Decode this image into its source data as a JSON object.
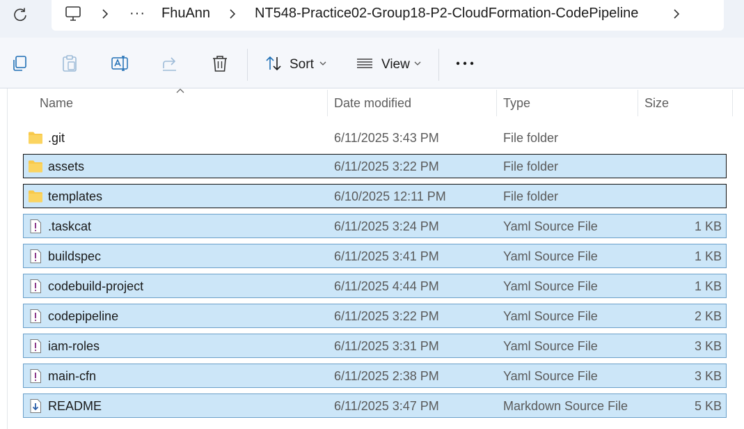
{
  "breadcrumb": {
    "more": "···",
    "items": [
      "FhuAnn",
      "NT548-Practice02-Group18-P2-CloudFormation-CodePipeline"
    ]
  },
  "toolbar": {
    "sort_label": "Sort",
    "view_label": "View",
    "more_label": "•••"
  },
  "columns": {
    "name": "Name",
    "date": "Date modified",
    "type": "Type",
    "size": "Size"
  },
  "files": [
    {
      "name": ".git",
      "date": "6/11/2025 3:43 PM",
      "type": "File folder",
      "size": "",
      "icon": "folder-icon"
    },
    {
      "name": "assets",
      "date": "6/11/2025 3:22 PM",
      "type": "File folder",
      "size": "",
      "icon": "folder-icon"
    },
    {
      "name": "templates",
      "date": "6/10/2025 12:11 PM",
      "type": "File folder",
      "size": "",
      "icon": "folder-icon"
    },
    {
      "name": ".taskcat",
      "date": "6/11/2025 3:24 PM",
      "type": "Yaml Source File",
      "size": "1 KB",
      "icon": "yaml-file-icon"
    },
    {
      "name": "buildspec",
      "date": "6/11/2025 3:41 PM",
      "type": "Yaml Source File",
      "size": "1 KB",
      "icon": "yaml-file-icon"
    },
    {
      "name": "codebuild-project",
      "date": "6/11/2025 4:44 PM",
      "type": "Yaml Source File",
      "size": "1 KB",
      "icon": "yaml-file-icon"
    },
    {
      "name": "codepipeline",
      "date": "6/11/2025 3:22 PM",
      "type": "Yaml Source File",
      "size": "2 KB",
      "icon": "yaml-file-icon"
    },
    {
      "name": "iam-roles",
      "date": "6/11/2025 3:31 PM",
      "type": "Yaml Source File",
      "size": "3 KB",
      "icon": "yaml-file-icon"
    },
    {
      "name": "main-cfn",
      "date": "6/11/2025 2:38 PM",
      "type": "Yaml Source File",
      "size": "3 KB",
      "icon": "yaml-file-icon"
    },
    {
      "name": "README",
      "date": "6/11/2025 3:47 PM",
      "type": "Markdown Source File",
      "size": "5 KB",
      "icon": "markdown-file-icon"
    }
  ],
  "colors": {
    "selection": "#cce6f8",
    "selection_border": "#6a9fc9",
    "folder": "#f8c94a"
  }
}
